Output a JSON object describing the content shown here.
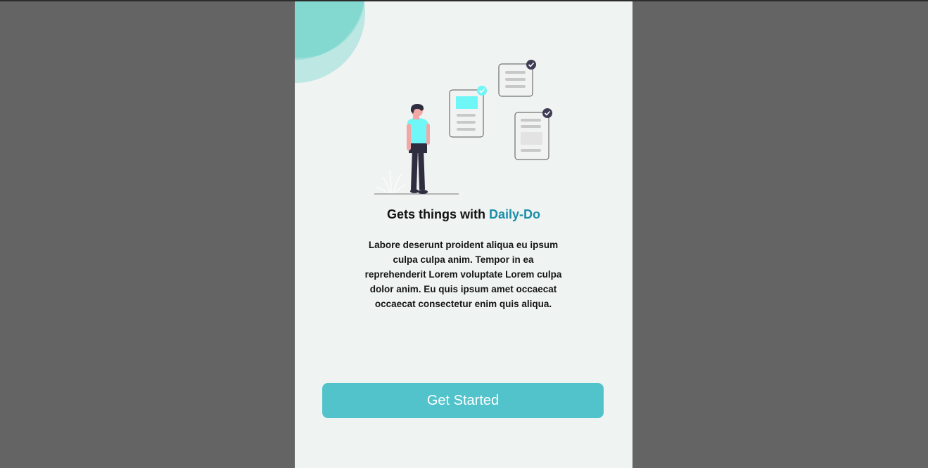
{
  "onboarding": {
    "headline_prefix": "Gets things with ",
    "headline_brand": "Daily-Do",
    "description": "Labore deserunt proident aliqua eu ipsum culpa culpa anim. Tempor in ea reprehenderit Lorem voluptate Lorem culpa dolor anim. Eu quis ipsum amet occaecat occaecat consectetur enim quis aliqua.",
    "cta_label": "Get Started"
  },
  "illustration": {
    "icon": "person-with-checklists-illustration"
  },
  "colors": {
    "page_background": "#646464",
    "card_background": "#eff3f2",
    "blob": "#54cdc1",
    "brand_text": "#1b8fa9",
    "button": "#52c3cb",
    "button_text": "#ffffff",
    "shirt": "#6ff6f6",
    "dark_accent": "#3f3d56"
  }
}
